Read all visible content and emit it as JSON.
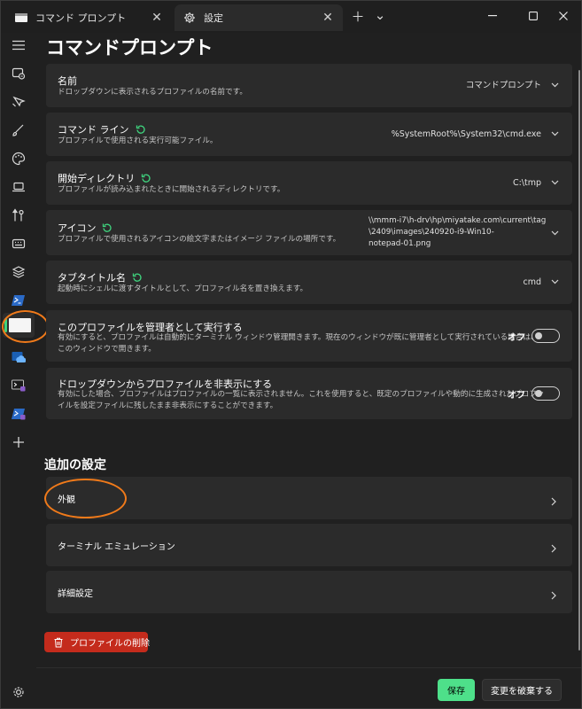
{
  "tabs": [
    {
      "label": "コマンド プロンプト",
      "icon": "cmd-icon"
    },
    {
      "label": "設定",
      "icon": "gear-icon"
    }
  ],
  "titlebar": {
    "new_tab": "＋",
    "dropdown": "⌄"
  },
  "window_controls": {
    "minimize": "—",
    "maximize": "☐",
    "close": "✕"
  },
  "page": {
    "title": "コマンドプロンプト"
  },
  "settings": [
    {
      "title": "名前",
      "desc": "ドロップダウンに表示されるプロファイルの名前です。",
      "value": "コマンドプロンプト",
      "reset": false
    },
    {
      "title": "コマンド ライン",
      "desc": "プロファイルで使用される実行可能ファイル。",
      "value": "%SystemRoot%\\System32\\cmd.exe",
      "reset": true
    },
    {
      "title": "開始ディレクトリ",
      "desc": "プロファイルが読み込まれたときに開始されるディレクトリです。",
      "value": "C:\\tmp",
      "reset": true
    },
    {
      "title": "アイコン",
      "desc": "プロファイルで使用されるアイコンの絵文字またはイメージ ファイルの場所です。",
      "value_lines": [
        "\\\\mmm-i7\\h-drv\\hp\\miyatake.com\\current\\tag",
        "\\2409\\images\\240920-i9-Win10-",
        "notepad-01.png"
      ],
      "reset": true
    },
    {
      "title": "タブタイトル名",
      "desc": "起動時にシェルに渡すタイトルとして、プロファイル名を置き換えます。",
      "value": "cmd",
      "reset": true
    }
  ],
  "toggles": [
    {
      "title": "このプロファイルを管理者として実行する",
      "desc_lines": [
        "有効にすると、プロファイルは自動的にターミナル ウィンドウ管理開きます。現在のウィンドウが既に管理者として実行されている場合は、",
        "このウィンドウで開きます。"
      ],
      "state_label": "オフ",
      "on": false
    },
    {
      "title": "ドロップダウンからプロファイルを非表示にする",
      "desc_lines": [
        "有効にした場合、プロファイルはプロファイルの一覧に表示されません。これを使用すると、既定のプロファイルや動的に生成されたプロファ",
        "イルを設定ファイルに残したまま非表示にすることができます。"
      ],
      "state_label": "オフ",
      "on": false
    }
  ],
  "additional": {
    "title": "追加の設定",
    "items": [
      "外観",
      "ターミナル エミュレーション",
      "詳細設定"
    ]
  },
  "delete_button": {
    "label": "プロファイルの削除",
    "color": "#c42b1c"
  },
  "footer": {
    "save": "保存",
    "discard": "変更を破棄する"
  },
  "colors": {
    "accent": "#4ee08a",
    "reset_icon": "#3fd47e",
    "annotation": "#f07a1a",
    "background": "#202020",
    "card": "#2b2b2b"
  },
  "rail_icons": [
    "hamburger-icon",
    "startup-icon",
    "interaction-icon",
    "appearance-icon",
    "color-schemes-icon",
    "rendering-icon",
    "compatibility-icon",
    "actions-icon",
    "defaults-icon",
    "powershell-icon",
    "command-prompt-icon",
    "azure-cloud-shell-icon",
    "developer-cmd-icon",
    "developer-powershell-icon",
    "add-profile-icon",
    "settings-gear-icon"
  ]
}
